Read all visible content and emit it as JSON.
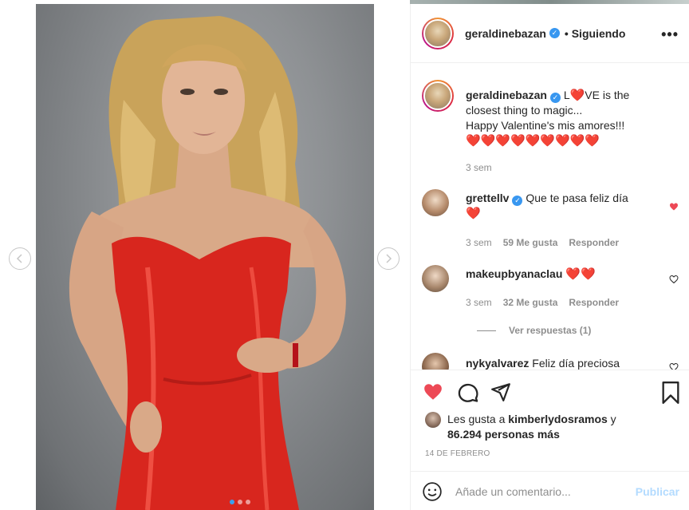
{
  "post": {
    "author": "geraldinebazan",
    "follow_status": "Siguiendo",
    "more_label": "•••",
    "verified_mark": "✓",
    "caption_before": "L",
    "caption_heart": "❤️",
    "caption_after": "VE is the closest thing to magic...",
    "caption_line2": "Happy Valentine's mis amores!!!",
    "caption_hearts": "❤️❤️❤️❤️❤️❤️❤️❤️❤️",
    "caption_time": "3 sem",
    "carousel": {
      "slides": 3,
      "active_slide": 1
    }
  },
  "comments": [
    {
      "user": "grettellv",
      "verified": true,
      "text": "Que te pasa feliz día",
      "hearts": "❤️",
      "time": "3 sem",
      "likes": "59 Me gusta",
      "reply": "Responder",
      "liked": true
    },
    {
      "user": "makeupbyanaclau",
      "verified": false,
      "text": "❤️❤️",
      "time": "3 sem",
      "likes": "32 Me gusta",
      "reply": "Responder",
      "liked": false,
      "view_replies": "Ver respuestas (1)"
    },
    {
      "user": "nykyalvarez",
      "verified": false,
      "text": "Feliz día preciosa"
    }
  ],
  "likes": {
    "prefix": "Les gusta a",
    "user": "kimberlydosramos",
    "connector": "y",
    "others": "86.294 personas más"
  },
  "date": "14 DE FEBRERO",
  "add_comment": {
    "placeholder": "Añade un comentario...",
    "publish": "Publicar"
  },
  "colors": {
    "heart_red": "#ed4956",
    "verified_blue": "#3897f0",
    "publish_disabled": "#b3dbff"
  }
}
